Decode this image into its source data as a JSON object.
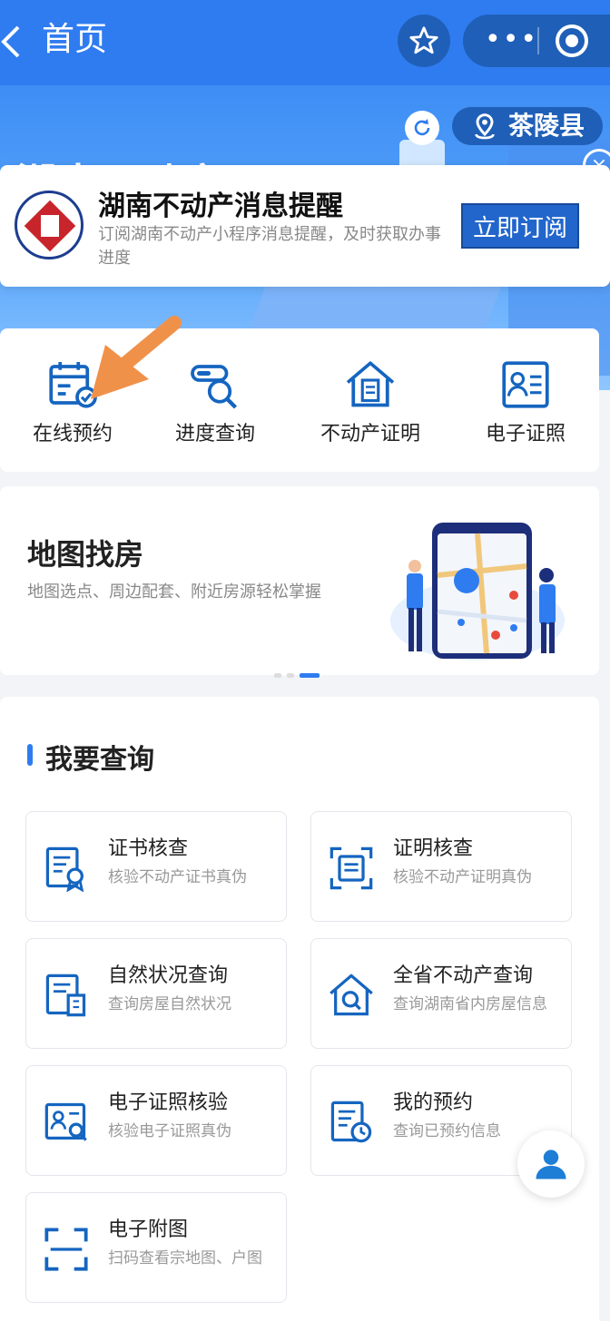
{
  "header": {
    "title": "首页"
  },
  "hero": {
    "title_peek": "湖南不动产",
    "location": "茶陵县"
  },
  "notification": {
    "title": "湖南不动产消息提醒",
    "description": "订阅湖南不动产小程序消息提醒，及时获取办事进度",
    "button": "立即订阅"
  },
  "quick_services": [
    {
      "label": "在线预约",
      "icon": "calendar-check-icon"
    },
    {
      "label": "进度查询",
      "icon": "progress-search-icon"
    },
    {
      "label": "不动产证明",
      "icon": "house-document-icon"
    },
    {
      "label": "电子证照",
      "icon": "id-card-icon"
    }
  ],
  "map_banner": {
    "title": "地图找房",
    "description": "地图选点、周边配套、附近房源轻松掌握"
  },
  "query": {
    "title": "我要查询",
    "items": [
      {
        "title": "证书核查",
        "desc": "核验不动产证书真伪",
        "icon": "certificate-icon"
      },
      {
        "title": "证明核查",
        "desc": "核验不动产证明真伪",
        "icon": "document-scan-icon"
      },
      {
        "title": "自然状况查询",
        "desc": "查询房屋自然状况",
        "icon": "building-document-icon"
      },
      {
        "title": "全省不动产查询",
        "desc": "查询湖南省内房屋信息",
        "icon": "house-search-icon"
      },
      {
        "title": "电子证照核验",
        "desc": "核验电子证照真伪",
        "icon": "id-card-search-icon"
      },
      {
        "title": "我的预约",
        "desc": "查询已预约信息",
        "icon": "document-clock-icon"
      },
      {
        "title": "电子附图",
        "desc": "扫码查看宗地图、户图",
        "icon": "scan-icon"
      }
    ]
  },
  "colors": {
    "primary": "#2f7cf0",
    "icon_blue": "#1565c0",
    "highlight_arrow": "#f0914a"
  }
}
